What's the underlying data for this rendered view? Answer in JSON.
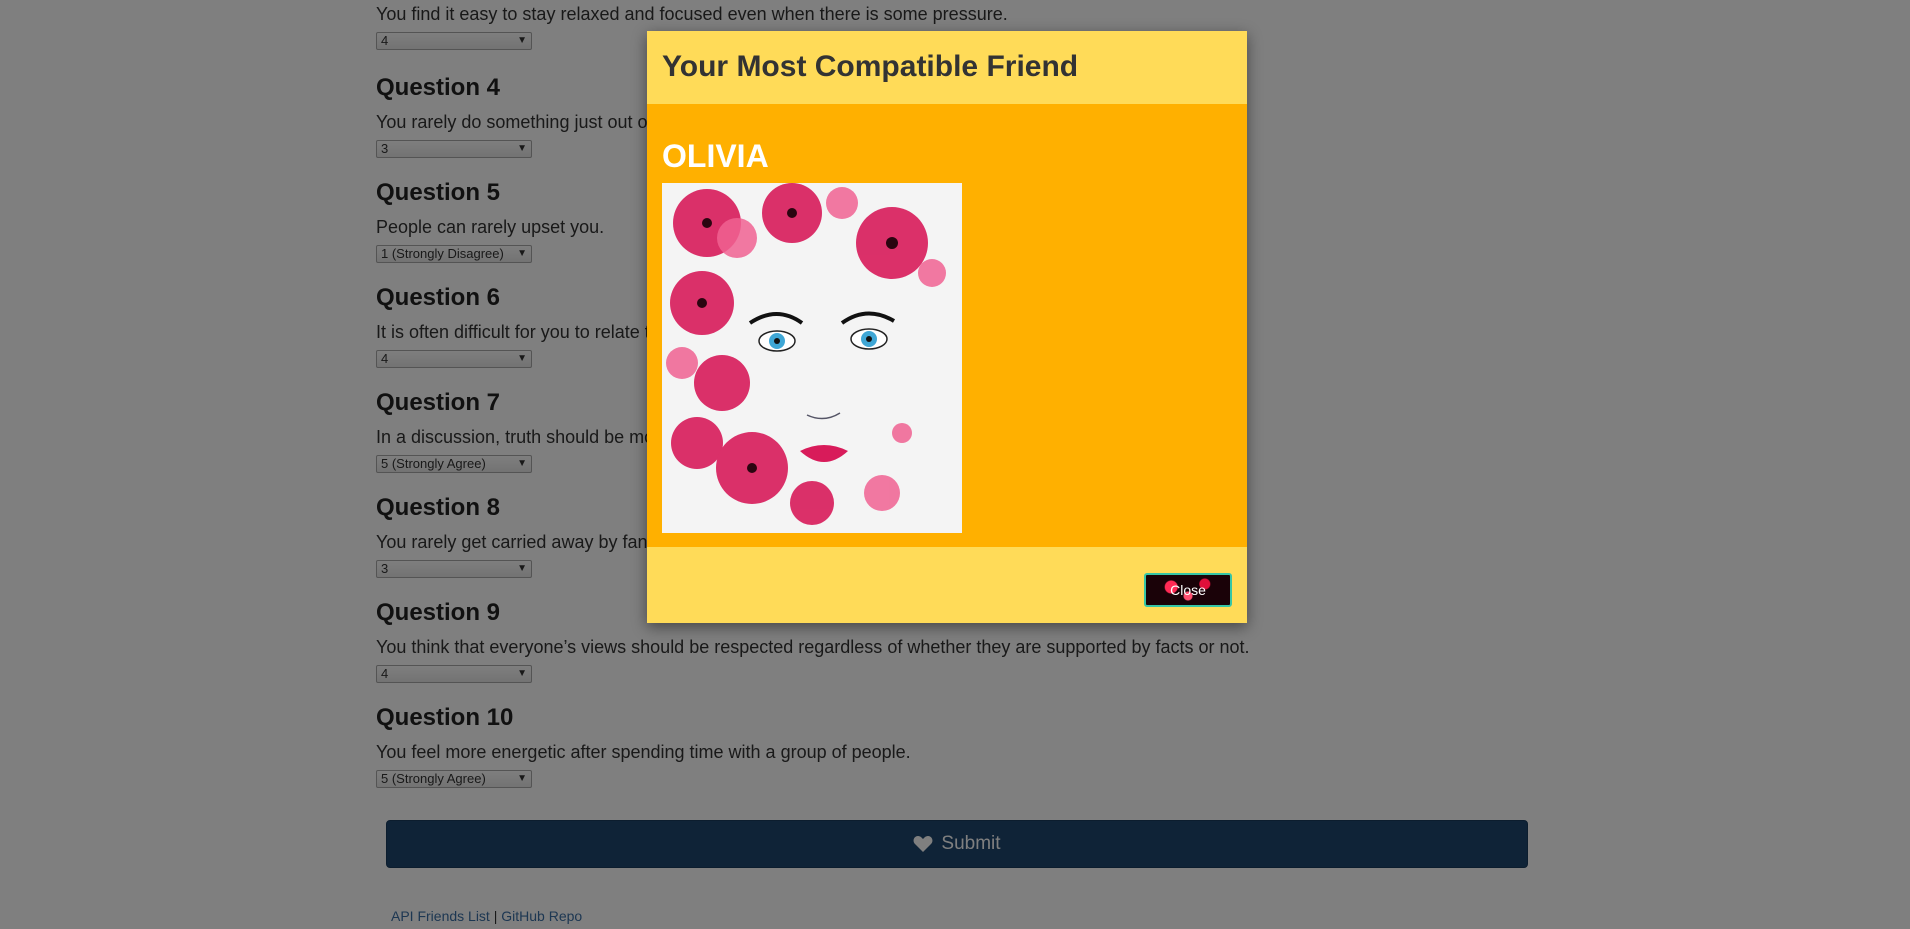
{
  "survey": {
    "partial_text": "You find it easy to stay relaxed and focused even when there is some pressure.",
    "partial_answer": "4",
    "questions": [
      {
        "title": "Question 4",
        "text": "You rarely do something just out of sheer curiosity.",
        "answer": "3"
      },
      {
        "title": "Question 5",
        "text": "People can rarely upset you.",
        "answer": "1 (Strongly Disagree)"
      },
      {
        "title": "Question 6",
        "text": "It is often difficult for you to relate to other people’s feelings.",
        "answer": "4"
      },
      {
        "title": "Question 7",
        "text": "In a discussion, truth should be more important than people’s sensitivities.",
        "answer": "5 (Strongly Agree)"
      },
      {
        "title": "Question 8",
        "text": "You rarely get carried away by fantasies and ideas.",
        "answer": "3"
      },
      {
        "title": "Question 9",
        "text": "You think that everyone’s views should be respected regardless of whether they are supported by facts or not.",
        "answer": "4"
      },
      {
        "title": "Question 10",
        "text": "You feel more energetic after spending time with a group of people.",
        "answer": "5 (Strongly Agree)"
      }
    ],
    "submit_label": "Submit"
  },
  "footer": {
    "api_link": "API Friends List",
    "separator": "|",
    "github_link": "GitHub Repo"
  },
  "modal": {
    "title": "Your Most Compatible Friend",
    "friend_name": "OLIVIA",
    "close_label": "Close"
  },
  "icons": {
    "submit": "heart-icon",
    "select_caret": "caret-down-icon"
  },
  "colors": {
    "modal_header": "#ffdb58",
    "modal_body": "#ffb000",
    "submit_button": "#1e466e"
  }
}
